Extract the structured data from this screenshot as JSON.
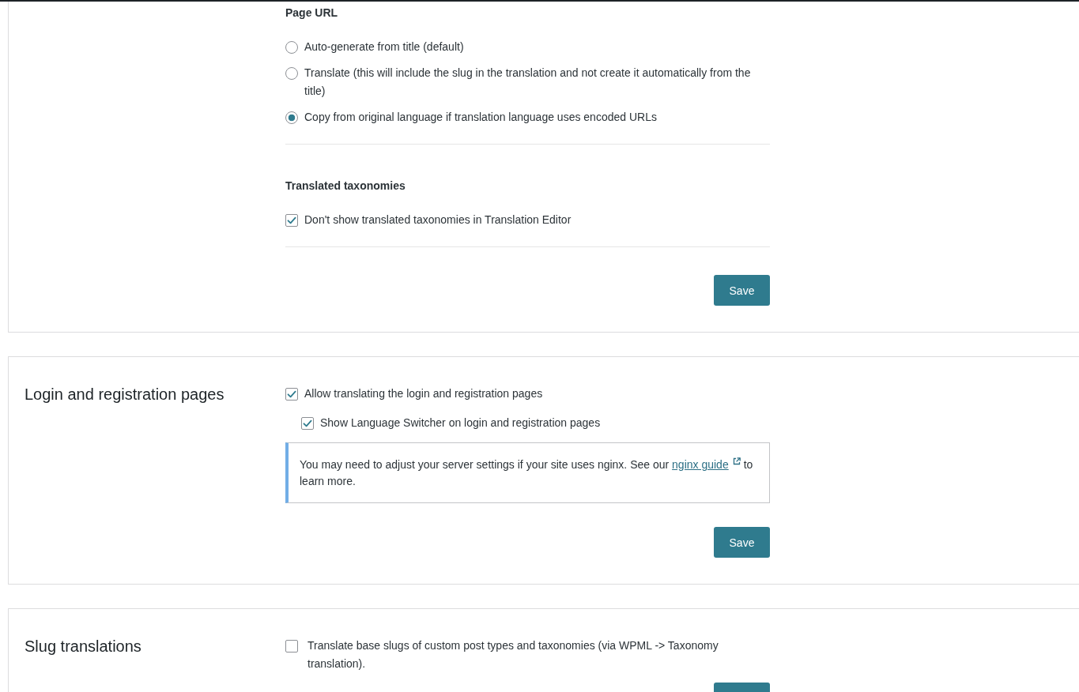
{
  "sections": [
    {
      "groups": [
        {
          "heading": "Page URL",
          "kind": "radio",
          "options": [
            {
              "label": "Auto-generate from title (default)",
              "selected": false
            },
            {
              "label": "Translate (this will include the slug in the translation and not create it automatically from the title)",
              "selected": false
            },
            {
              "label": "Copy from original language if translation language uses encoded URLs",
              "selected": true
            }
          ]
        },
        {
          "heading": "Translated taxonomies",
          "kind": "checkbox",
          "options": [
            {
              "label": "Don't show translated taxonomies in Translation Editor",
              "checked": true
            }
          ]
        }
      ],
      "actions": [
        {
          "kind": "save",
          "label": "Save"
        }
      ]
    },
    {
      "title": "Login and registration pages",
      "groups": [
        {
          "kind": "checkbox",
          "options": [
            {
              "label": "Allow translating the login and registration pages",
              "checked": true,
              "children": [
                {
                  "label": "Show Language Switcher on login and registration pages",
                  "checked": true
                }
              ]
            }
          ]
        }
      ],
      "notice": {
        "text": "You may need to adjust your server settings if your site uses nginx. See our",
        "link": "nginx guide",
        "text_after": "to learn more."
      },
      "actions": [
        {
          "kind": "save",
          "label": "Save"
        }
      ]
    },
    {
      "title": "Slug translations",
      "groups": [
        {
          "kind": "checkbox",
          "options": [
            {
              "label": "Translate base slugs of custom post types and taxonomies (via WPML -> Taxonomy translation).",
              "checked": false
            }
          ]
        }
      ],
      "actions": [
        {
          "kind": "save"
        }
      ]
    }
  ]
}
